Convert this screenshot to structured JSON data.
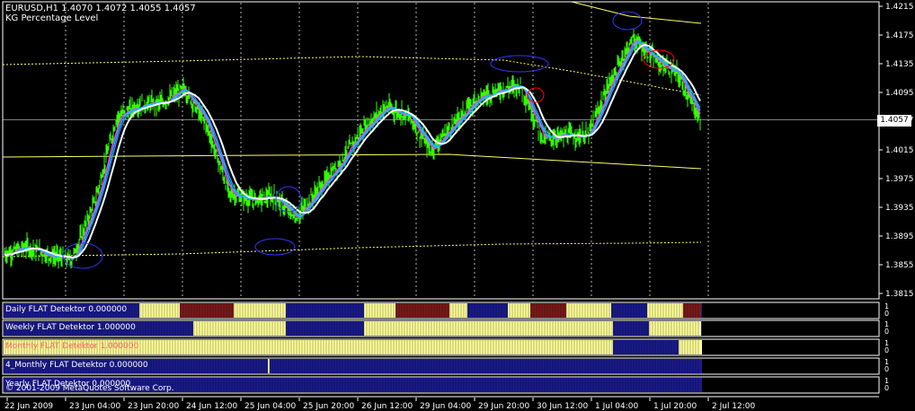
{
  "header": {
    "symbol_line": "EURUSD,H1  1.4070 1.4072 1.4055 1.4057",
    "indicator_name": "KG Percentage Level"
  },
  "colors": {
    "background": "#000000",
    "candles": "#33ff00",
    "grid": "#ffffff",
    "band": "#ffff66",
    "ma_fast": "#ff33ff",
    "ma_mid": "#00ccff",
    "ma_slow": "#ffffff",
    "ellipse_blue": "#3333ff",
    "ellipse_red": "#ff0000",
    "flat_blue": "#1a1a8c",
    "flat_yellow": "#ffff99",
    "flat_red": "#7a1a1a"
  },
  "price_axis": {
    "ticks": [
      "1.4215",
      "1.4175",
      "1.4135",
      "1.4095",
      "1.4057",
      "1.4015",
      "1.3975",
      "1.3935",
      "1.3895",
      "1.3855",
      "1.3815"
    ],
    "current_price": "1.4057"
  },
  "time_axis": {
    "ticks": [
      "22 Jun 2009",
      "23 Jun 04:00",
      "23 Jun 20:00",
      "24 Jun 12:00",
      "25 Jun 04:00",
      "25 Jun 20:00",
      "26 Jun 12:00",
      "29 Jun 04:00",
      "29 Jun 20:00",
      "30 Jun 12:00",
      "1 Jul 04:00",
      "1 Jul 20:00",
      "2 Jul 12:00"
    ]
  },
  "indicators": [
    {
      "label": "Daily FLAT Detektor 0.000000",
      "label_color": "#ffffff",
      "scale": [
        "1",
        "0"
      ]
    },
    {
      "label": "Weekly FLAT Detektor 1.000000",
      "label_color": "#ffffff",
      "scale": [
        "1",
        "0"
      ]
    },
    {
      "label": "Monthly FLAT Detektor 1.000000",
      "label_color": "#ff6666",
      "scale": [
        "1",
        "0"
      ]
    },
    {
      "label": "4_Monthly FLAT Detektor 0.000000",
      "label_color": "#ffffff",
      "scale": [
        "1",
        "0"
      ]
    },
    {
      "label": "Yearly FLAT Detektor 0.000000",
      "label_color": "#ffffff",
      "scale": [
        "1",
        "0"
      ]
    }
  ],
  "copyright": "© 2001-2009 MetaQuotes Software Corp.",
  "chart_data": {
    "type": "candlestick",
    "symbol": "EURUSD",
    "timeframe": "H1",
    "ylim": [
      1.3815,
      1.4215
    ],
    "close_path": [
      [
        "22 Jun 2009",
        1.387
      ],
      [
        "22 Jun 08:00",
        1.388
      ],
      [
        "22 Jun 16:00",
        1.3868
      ],
      [
        "23 Jun 04:00",
        1.3862
      ],
      [
        "23 Jun 10:00",
        1.394
      ],
      [
        "23 Jun 14:00",
        1.406
      ],
      [
        "23 Jun 20:00",
        1.4078
      ],
      [
        "24 Jun 02:00",
        1.408
      ],
      [
        "24 Jun 06:00",
        1.41
      ],
      [
        "24 Jun 12:00",
        1.405
      ],
      [
        "24 Jun 18:00",
        1.3955
      ],
      [
        "25 Jun 00:00",
        1.3945
      ],
      [
        "25 Jun 04:00",
        1.395
      ],
      [
        "25 Jun 10:00",
        1.392
      ],
      [
        "25 Jun 16:00",
        1.396
      ],
      [
        "25 Jun 20:00",
        1.4
      ],
      [
        "26 Jun 04:00",
        1.4045
      ],
      [
        "26 Jun 12:00",
        1.4075
      ],
      [
        "26 Jun 20:00",
        1.4062
      ],
      [
        "29 Jun 04:00",
        1.4015
      ],
      [
        "29 Jun 12:00",
        1.405
      ],
      [
        "29 Jun 20:00",
        1.4085
      ],
      [
        "30 Jun 04:00",
        1.4098
      ],
      [
        "30 Jun 08:00",
        1.4105
      ],
      [
        "30 Jun 12:00",
        1.403
      ],
      [
        "30 Jun 20:00",
        1.4035
      ],
      [
        "1 Jul 04:00",
        1.4035
      ],
      [
        "1 Jul 10:00",
        1.411
      ],
      [
        "1 Jul 14:00",
        1.417
      ],
      [
        "1 Jul 20:00",
        1.414
      ],
      [
        "2 Jul 04:00",
        1.412
      ],
      [
        "2 Jul 12:00",
        1.4057
      ]
    ],
    "current_price": 1.4057
  }
}
